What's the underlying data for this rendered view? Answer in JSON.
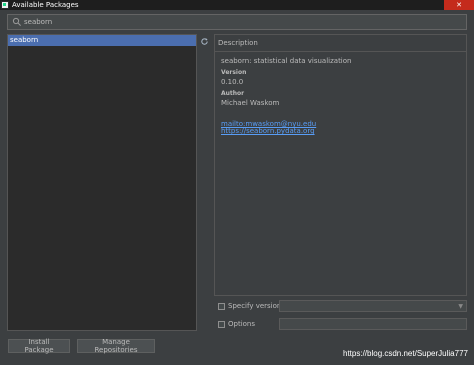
{
  "window": {
    "title": "Available Packages",
    "close_glyph": "✕"
  },
  "search": {
    "value": "seaborn",
    "placeholder": ""
  },
  "packages": [
    {
      "name": "seaborn",
      "selected": true
    }
  ],
  "description": {
    "header": "Description",
    "summary": "seaborn: statistical data visualization",
    "version_label": "Version",
    "version": "0.10.0",
    "author_label": "Author",
    "author": "Michael Waskom",
    "links": [
      "mailto:mwaskom@nyu.edu",
      "https://seaborn.pydata.org"
    ]
  },
  "options": {
    "specify_version_label": "Specify version",
    "options_label": "Options"
  },
  "buttons": {
    "install": "Install Package",
    "manage_repos": "Manage Repositories"
  },
  "watermark": "https://blog.csdn.net/SuperJulia777",
  "colors": {
    "background": "#3c3f41",
    "list_background": "#2b2b2b",
    "selection": "#4b6eaf",
    "link": "#589df6",
    "close": "#c42b1c"
  },
  "icons": {
    "app": "pycharm-icon",
    "search": "search-icon",
    "refresh": "refresh-icon",
    "dropdown": "chevron-down-icon"
  }
}
